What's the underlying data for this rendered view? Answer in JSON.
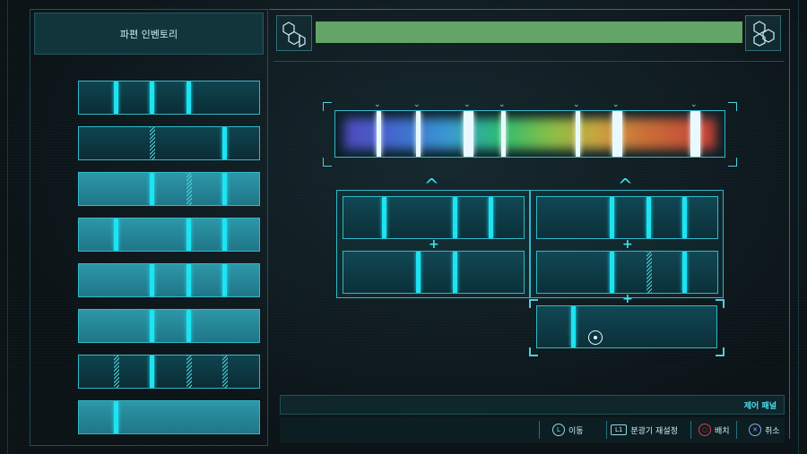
{
  "inventory": {
    "title": "파편 인벤토리",
    "fragments": [
      {
        "style": "dark",
        "lines": [
          {
            "x": 0.2
          },
          {
            "x": 0.4
          },
          {
            "x": 0.6
          }
        ]
      },
      {
        "style": "dark",
        "lines": [
          {
            "x": 0.4,
            "hatch": true
          },
          {
            "x": 0.8
          }
        ]
      },
      {
        "style": "light",
        "lines": [
          {
            "x": 0.4
          },
          {
            "x": 0.6,
            "hatch": true
          },
          {
            "x": 0.8
          }
        ]
      },
      {
        "style": "light",
        "lines": [
          {
            "x": 0.2
          },
          {
            "x": 0.6
          },
          {
            "x": 0.8
          }
        ]
      },
      {
        "style": "light",
        "lines": [
          {
            "x": 0.4
          },
          {
            "x": 0.6
          },
          {
            "x": 0.8
          }
        ]
      },
      {
        "style": "light",
        "lines": [
          {
            "x": 0.4
          },
          {
            "x": 0.6
          }
        ]
      },
      {
        "style": "dark",
        "lines": [
          {
            "x": 0.2,
            "hatch": true
          },
          {
            "x": 0.4
          },
          {
            "x": 0.6,
            "hatch": true
          },
          {
            "x": 0.8,
            "hatch": true
          }
        ]
      },
      {
        "style": "light",
        "lines": [
          {
            "x": 0.2
          }
        ]
      }
    ]
  },
  "progress": {
    "fraction": 1.0,
    "color": "#62a566"
  },
  "spectrum": {
    "markers": [
      0.11,
      0.21,
      0.34,
      0.43,
      0.62,
      0.72,
      0.92
    ],
    "thick_markers": [
      0.34,
      0.72,
      0.92
    ]
  },
  "slots": {
    "left_top": [
      0.22,
      0.61,
      0.81
    ],
    "left_bottom": [
      0.41,
      0.61
    ],
    "right_top": [
      0.41,
      0.61,
      0.81
    ],
    "right_bottom": [
      {
        "x": 0.41
      },
      {
        "x": 0.61,
        "hatch": true
      },
      {
        "x": 0.81
      }
    ],
    "result": [
      0.2
    ]
  },
  "controls": {
    "panel_label": "제어 패널",
    "move_label": "이동",
    "move_icon": "L",
    "reset_key": "L1",
    "reset_label": "분광기 재설정",
    "place_label": "배치",
    "cancel_label": "취소"
  },
  "colors": {
    "accent": "#1de3f2",
    "confirm": "#e0384a",
    "cancel": "#8aa8e8"
  }
}
